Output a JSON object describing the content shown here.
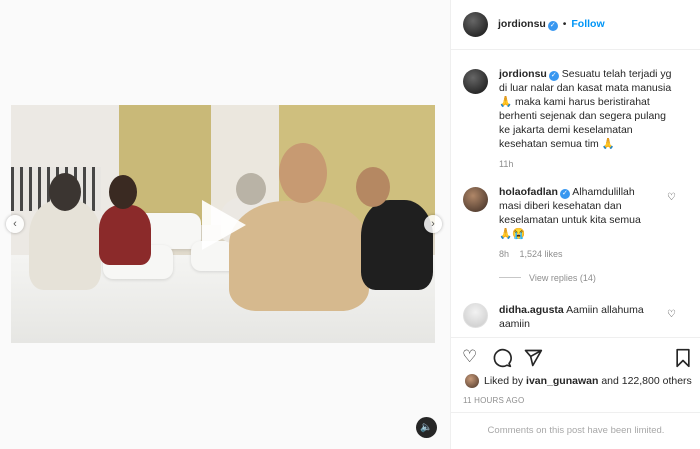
{
  "post": {
    "author": "jordionsu",
    "follow_label": "Follow",
    "dot": "•"
  },
  "caption": {
    "author": "jordionsu",
    "lines": [
      "Sesuatu telah terjadi yg",
      "di luar nalar dan kasat mata manusia",
      "maka kami harus beristirahat",
      "berhenti sejenak dan segera pulang",
      "ke jakarta demi keselamatan",
      "kesehatan semua tim"
    ],
    "pray_emoji": "🙏",
    "time": "11h"
  },
  "comments": [
    {
      "author": "holaofadlan",
      "lines": [
        "Alhamdulillah",
        "masi diberi kesehatan dan",
        "keselamatan untuk kita semua"
      ],
      "emojis": "🙏😭",
      "time": "8h",
      "likes": "1,524 likes",
      "replies": "View replies (14)"
    },
    {
      "author": "didha.agusta",
      "lines": [
        "Aamiin allahuma",
        "aamiin"
      ]
    }
  ],
  "likes": {
    "liked_by_prefix": "Liked by",
    "liked_by_user": "ivan_gunawan",
    "and_others": "and 122,800 others",
    "timestamp": "11 HOURS AGO"
  },
  "comments_limited": "Comments on this post have been limited.",
  "icons": {
    "like": "heart-icon",
    "comment": "comment-icon",
    "share": "share-icon",
    "save": "bookmark-icon",
    "sound": "speaker-icon",
    "prev": "chevron-left-icon",
    "next": "chevron-right-icon",
    "verified": "verified-badge-icon"
  },
  "colors": {
    "accent": "#0095f6",
    "verified": "#3897f0",
    "muted": "#8e8e8e"
  }
}
